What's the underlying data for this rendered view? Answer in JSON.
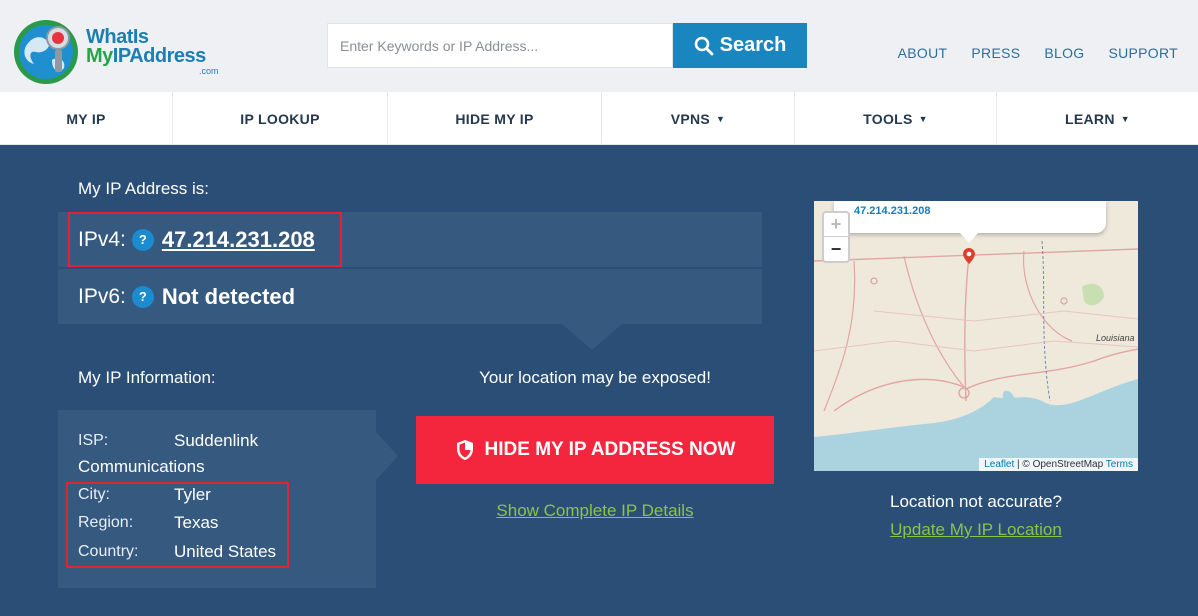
{
  "logo": {
    "line1": "WhatIs",
    "line2_green": "My",
    "line2_blue": "IPAddress",
    "suffix": ".com"
  },
  "search": {
    "placeholder": "Enter Keywords or IP Address...",
    "button_label": "Search"
  },
  "top_links": [
    "ABOUT",
    "PRESS",
    "BLOG",
    "SUPPORT"
  ],
  "nav": [
    {
      "label": "MY IP",
      "dropdown": false
    },
    {
      "label": "IP LOOKUP",
      "dropdown": false
    },
    {
      "label": "HIDE MY IP",
      "dropdown": false
    },
    {
      "label": "VPNS",
      "dropdown": true
    },
    {
      "label": "TOOLS",
      "dropdown": true
    },
    {
      "label": "LEARN",
      "dropdown": true
    }
  ],
  "ip": {
    "heading": "My IP Address is:",
    "ipv4_label": "IPv4:",
    "ipv4_value": "47.214.231.208",
    "ipv6_label": "IPv6:",
    "ipv6_value": "Not detected",
    "help_glyph": "?"
  },
  "info": {
    "heading": "My IP Information:",
    "isp_key": "ISP:",
    "isp_value_1": "Suddenlink",
    "isp_value_2": "Communications",
    "city_key": "City:",
    "city_value": "Tyler",
    "region_key": "Region:",
    "region_value": "Texas",
    "country_key": "Country:",
    "country_value": "United States"
  },
  "exposure": {
    "message": "Your location may be exposed!",
    "button_label": "HIDE MY IP ADDRESS NOW",
    "details_link": "Show Complete IP Details"
  },
  "map": {
    "popup_ip": "47.214.231.208",
    "zoom_in": "+",
    "zoom_out": "−",
    "attribution_leaflet": "Leaflet",
    "attribution_sep": " | © OpenStreetMap ",
    "attribution_terms": "Terms",
    "state_label": "Louisiana"
  },
  "location": {
    "question": "Location not accurate?",
    "update_link": "Update My IP Location"
  },
  "colors": {
    "background": "#2a4e76",
    "panel": "#35597f",
    "accent_blue": "#1a86c0",
    "danger_red": "#f4263d",
    "link_green": "#8bc34a",
    "highlight_box": "#e02431"
  },
  "icons": {
    "search": "magnifier-icon",
    "shield": "shield-icon",
    "globe": "globe-icon",
    "pin": "map-pin-icon"
  }
}
